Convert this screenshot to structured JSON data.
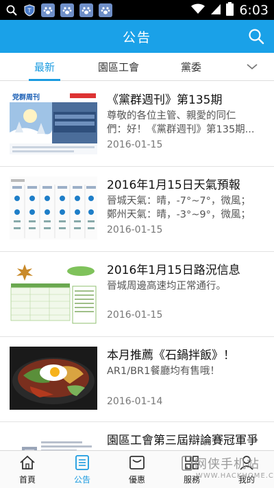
{
  "status_bar": {
    "time": "6:03",
    "left_icons": [
      "search-icon",
      "shield-icon",
      "paw-icon",
      "paw-icon",
      "paw-icon",
      "paw-icon"
    ],
    "right_icons": [
      "wifi-icon",
      "signal-icon",
      "battery-icon"
    ]
  },
  "app_bar": {
    "title": "公告"
  },
  "tabs": [
    {
      "label": "最新",
      "active": true
    },
    {
      "label": "園區工會",
      "active": false
    },
    {
      "label": "黨委",
      "active": false
    }
  ],
  "articles": [
    {
      "title": "《黨群週刊》第135期",
      "description_lines": [
        "尊敬的各位主管、親愛的同仁",
        "們：好！《黨群週刊》第135期..."
      ],
      "date": "2016-01-15",
      "thumb_text": "党群周刊"
    },
    {
      "title": "2016年1月15日天氣預報",
      "description_lines": [
        "晉城天氣：晴，-7°~7°，微風；",
        "鄭州天氣：晴，-3°~9°，微風；"
      ],
      "date": "2016-01-15"
    },
    {
      "title": "2016年1月15日路況信息",
      "description_lines": [
        "晉城周邊高速均正常通行。"
      ],
      "date": "2016-01-15"
    },
    {
      "title": "本月推薦《石鍋拌飯》！",
      "description_lines": [
        "AR1/BR1餐廳均有售哦！"
      ],
      "date": "2016-01-14"
    },
    {
      "title": "園區工會第三屆辯論賽冠軍爭",
      "description_lines": [],
      "date": ""
    }
  ],
  "bottom_nav": [
    {
      "label": "首頁",
      "icon": "home-icon",
      "active": false
    },
    {
      "label": "公告",
      "icon": "document-icon",
      "active": true
    },
    {
      "label": "優惠",
      "icon": "inbox-icon",
      "active": false
    },
    {
      "label": "服務",
      "icon": "grid-icon",
      "active": false
    },
    {
      "label": "我的",
      "icon": "person-icon",
      "active": false
    }
  ],
  "watermark": {
    "text": "网侠手机站",
    "url": "WWW.HACKHOME.COM"
  },
  "colors": {
    "accent": "#1aa1e8",
    "tab_active": "#1a9be0",
    "status_bar": "#000000"
  }
}
